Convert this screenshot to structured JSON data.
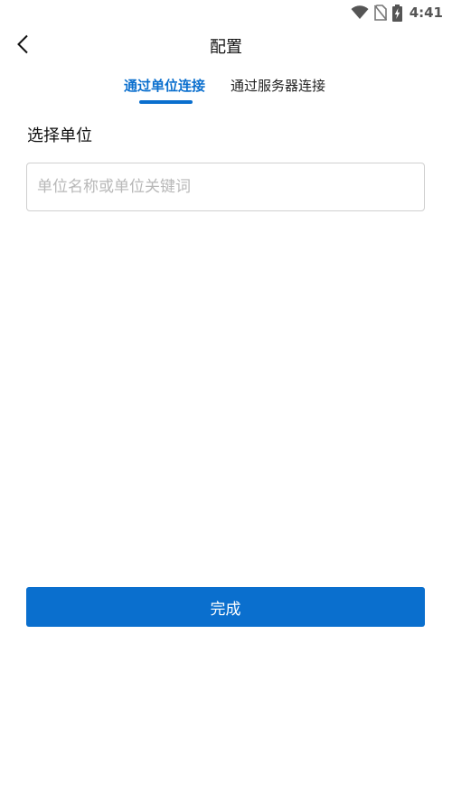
{
  "status_bar": {
    "time": "4:41",
    "icons": [
      "wifi-icon",
      "no-sim-icon",
      "battery-charging-icon"
    ]
  },
  "nav": {
    "title": "配置",
    "back_icon": "chevron-left-icon"
  },
  "tabs": [
    {
      "label": "通过单位连接",
      "active": true
    },
    {
      "label": "通过服务器连接",
      "active": false
    }
  ],
  "form": {
    "section_label": "选择单位",
    "search_placeholder": "单位名称或单位关键词",
    "search_value": ""
  },
  "actions": {
    "done_label": "完成"
  },
  "colors": {
    "accent": "#0a6fce",
    "border": "#cfcfcf",
    "placeholder": "#b8b8b8"
  }
}
